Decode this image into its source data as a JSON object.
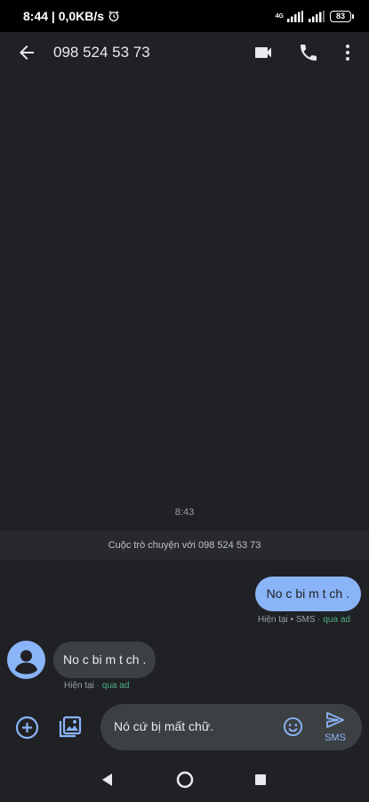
{
  "status_bar": {
    "time_speed": "8:44 | 0,0KB/s",
    "network_label": "4G",
    "battery": "83"
  },
  "header": {
    "title": "098 524 53 73"
  },
  "conversation": {
    "time_divider": "8:43",
    "banner": "Cuộc trò chuyện với 098 524 53 73",
    "outgoing": {
      "text": "No c  bi m t ch .",
      "meta_time": "Hiện tại • SMS",
      "meta_via": " · qua ad"
    },
    "incoming": {
      "text": "No c  bi m t ch .",
      "meta_time": "Hiện tại",
      "meta_via": " · qua ad"
    }
  },
  "compose": {
    "value": "Nó cứ bị mất chữ.",
    "send_label": "SMS"
  },
  "colors": {
    "background": "#202124",
    "accent_blue": "#8ab4f8",
    "bubble_incoming": "#3c4043",
    "via_green": "#4caf86"
  }
}
